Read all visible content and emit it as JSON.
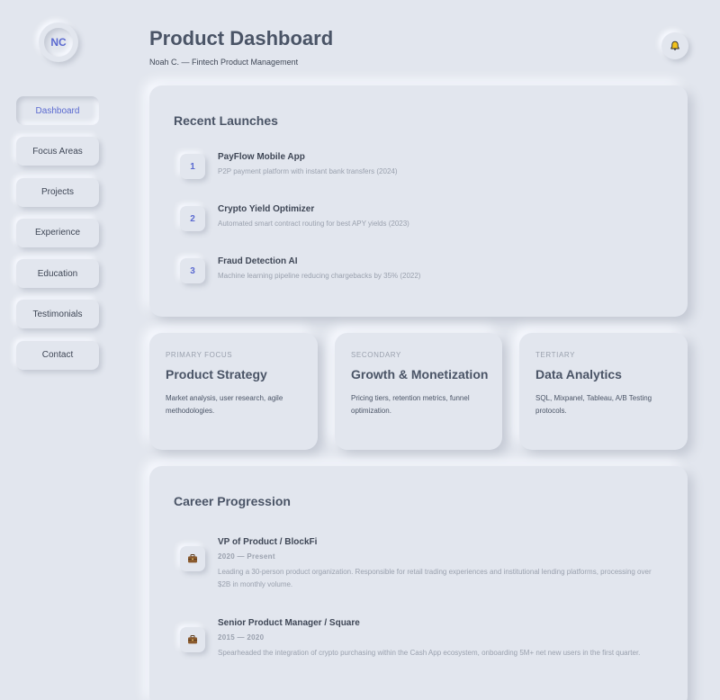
{
  "colors": {
    "background": "#e2e6ee",
    "accent": "#5b6ad0",
    "text": "#4a5466",
    "muted": "#9aa1ae"
  },
  "sidebar": {
    "avatar_initials": "NC",
    "items": [
      {
        "label": "Dashboard",
        "active": true
      },
      {
        "label": "Focus Areas"
      },
      {
        "label": "Projects"
      },
      {
        "label": "Experience"
      },
      {
        "label": "Education"
      },
      {
        "label": "Testimonials"
      },
      {
        "label": "Contact"
      }
    ]
  },
  "header": {
    "title": "Product Dashboard",
    "subtitle": "Noah C. — Fintech Product Management",
    "notification_icon": "bell-icon"
  },
  "launches": {
    "title": "Recent Launches",
    "items": [
      {
        "num": "1",
        "name": "PayFlow Mobile App",
        "desc": "P2P payment platform with instant bank transfers (2024)"
      },
      {
        "num": "2",
        "name": "Crypto Yield Optimizer",
        "desc": "Automated smart contract routing for best APY yields (2023)"
      },
      {
        "num": "3",
        "name": "Fraud Detection AI",
        "desc": "Machine learning pipeline reducing chargebacks by 35% (2022)"
      }
    ]
  },
  "focus": [
    {
      "kicker": "PRIMARY FOCUS",
      "title": "Product Strategy",
      "desc": "Market analysis, user research, agile methodologies."
    },
    {
      "kicker": "SECONDARY",
      "title": "Growth & Monetization",
      "desc": "Pricing tiers, retention metrics, funnel optimization."
    },
    {
      "kicker": "TERTIARY",
      "title": "Data Analytics",
      "desc": "SQL, Mixpanel, Tableau, A/B Testing protocols."
    }
  ],
  "career": {
    "title": "Career Progression",
    "jobs": [
      {
        "icon": "briefcase-icon",
        "title": "VP of Product / BlockFi",
        "dates": "2020 — Present",
        "desc": "Leading a 30-person product organization. Responsible for retail trading experiences and institutional lending platforms, processing over $2B in monthly volume."
      },
      {
        "icon": "briefcase-icon",
        "title": "Senior Product Manager / Square",
        "dates": "2015 — 2020",
        "desc": "Spearheaded the integration of crypto purchasing within the Cash App ecosystem, onboarding 5M+ net new users in the first quarter."
      }
    ]
  }
}
